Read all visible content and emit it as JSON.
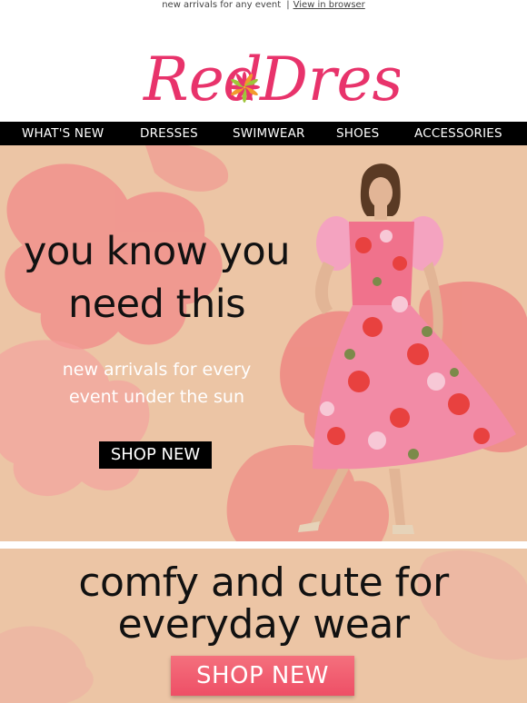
{
  "preheader": {
    "text": "new arrivals for any event",
    "separator": "|",
    "view_in_browser": "View in browser"
  },
  "brand": {
    "name": "Red Dress",
    "logo_word_1": "Red",
    "logo_word_2": "Dress",
    "brand_color": "#e8336b"
  },
  "nav": {
    "items": [
      {
        "label": "WHAT'S NEW"
      },
      {
        "label": "DRESSES"
      },
      {
        "label": "SWIMWEAR"
      },
      {
        "label": "SHOES"
      },
      {
        "label": "ACCESSORIES"
      }
    ]
  },
  "hero": {
    "headline_line1": "you know you",
    "headline_line2": "need this",
    "sub_line1": "new arrivals for every",
    "sub_line2": "event under the sun",
    "button_label": "SHOP NEW",
    "background_color": "#ecc5a5",
    "accent_color": "#f07a86"
  },
  "lower": {
    "headline_line1": "comfy and cute for",
    "headline_line2": "everyday wear",
    "button_label": "SHOP NEW",
    "button_color": "#ef5b6e"
  }
}
